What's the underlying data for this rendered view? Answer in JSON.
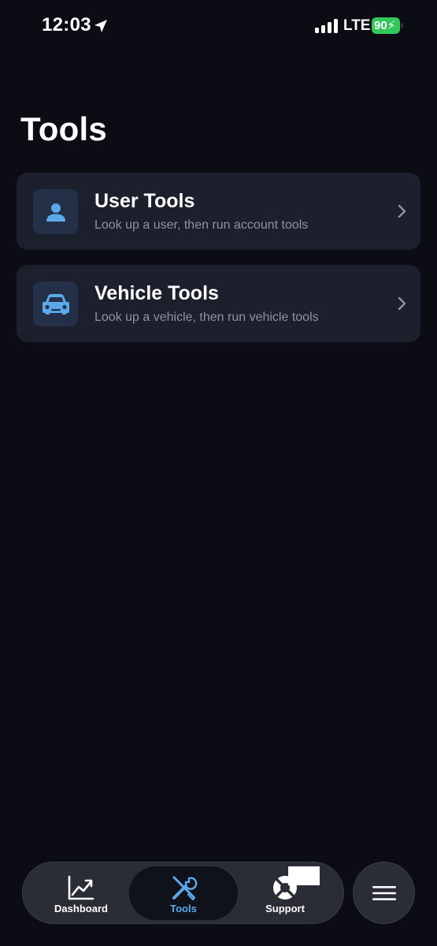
{
  "status_bar": {
    "time": "12:03",
    "network": "LTE",
    "battery": "90"
  },
  "page": {
    "title": "Tools"
  },
  "cards": [
    {
      "title": "User Tools",
      "subtitle": "Look up a user, then run account tools",
      "icon": "person-icon"
    },
    {
      "title": "Vehicle Tools",
      "subtitle": "Look up a vehicle, then run vehicle tools",
      "icon": "car-icon"
    }
  ],
  "tab_bar": {
    "tabs": [
      {
        "label": "Dashboard",
        "icon": "chart-line-icon",
        "selected": false
      },
      {
        "label": "Tools",
        "icon": "tools-icon",
        "selected": true
      },
      {
        "label": "Support",
        "icon": "lifebuoy-icon",
        "selected": false
      }
    ],
    "menu_icon": "hamburger-menu-icon"
  },
  "colors": {
    "background": "#0b0c14",
    "card": "#1c1f2c",
    "accent": "#5aa9ea",
    "battery": "#34c759",
    "subtitle": "#8e93a1"
  }
}
